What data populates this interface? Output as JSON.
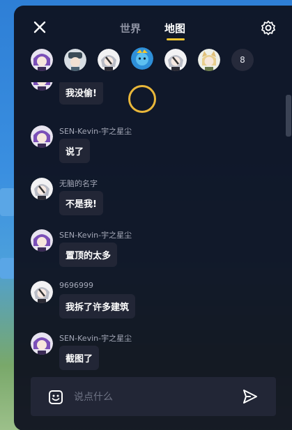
{
  "header": {
    "tabs": [
      {
        "label": "世界",
        "active": false
      },
      {
        "label": "地图",
        "active": true
      }
    ],
    "close_icon": "close-icon",
    "settings_icon": "gear-icon"
  },
  "online": {
    "avatars": [
      {
        "name": "purple-hair-avatar"
      },
      {
        "name": "dark-hat-avatar"
      },
      {
        "name": "silver-hair-avatar"
      },
      {
        "name": "blue-creature-avatar"
      },
      {
        "name": "silver-hair-avatar"
      },
      {
        "name": "blonde-cat-ear-avatar"
      }
    ],
    "more_count": "8"
  },
  "messages": [
    {
      "name": "",
      "text": "我没偷!"
    },
    {
      "name": "SEN-Kevin-宇之星尘",
      "text": "说了"
    },
    {
      "name": "无脑的名字",
      "text": "不是我!"
    },
    {
      "name": "SEN-Kevin-宇之星尘",
      "text": "置顶的太多"
    },
    {
      "name": "9696999",
      "text": "我拆了许多建筑"
    },
    {
      "name": "SEN-Kevin-宇之星尘",
      "text": "截图了"
    }
  ],
  "composer": {
    "placeholder": "说点什么",
    "emoji_icon": "emoji-icon",
    "send_icon": "send-icon"
  },
  "colors": {
    "panel": "#0e111f",
    "bubble": "#222636",
    "accent": "#f2c530",
    "text": "#ffffff",
    "muted": "#a5a9b8"
  }
}
